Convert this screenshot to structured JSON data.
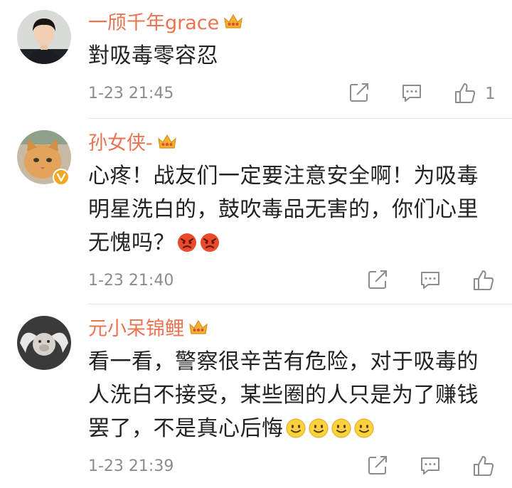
{
  "comments": [
    {
      "username": "一颀千年grace",
      "text": "對吸毒零容忍",
      "time": "1-23 21:45",
      "like_count": "1",
      "avatar_icon": "user-avatar-young-man",
      "verified": false,
      "emojis": []
    },
    {
      "username": "孙女侠-",
      "text": "心疼！战友们一定要注意安全啊！为吸毒明星洗白的，鼓吹毒品无害的，你们心里无愧吗？",
      "time": "1-23 21:40",
      "like_count": "",
      "avatar_icon": "user-avatar-cat",
      "verified": true,
      "emojis": [
        "angry-face-emoji",
        "angry-face-emoji"
      ]
    },
    {
      "username": "元小呆锦鲤",
      "text": "看一看，警察很辛苦有危险，对于吸毒的人洗白不接受，某些圈的人只是为了赚钱罢了，不是真心后悔",
      "time": "1-23 21:39",
      "like_count": "",
      "avatar_icon": "user-avatar-winged-pig",
      "verified": false,
      "emojis": [
        "smile-emoji",
        "smile-emoji",
        "smile-emoji",
        "smile-emoji"
      ]
    }
  ],
  "colors": {
    "username": "#eb7350",
    "text": "#222222",
    "meta": "#8c8c8c",
    "crown": "#f2b12e",
    "verified_badge": "#f5a623"
  }
}
